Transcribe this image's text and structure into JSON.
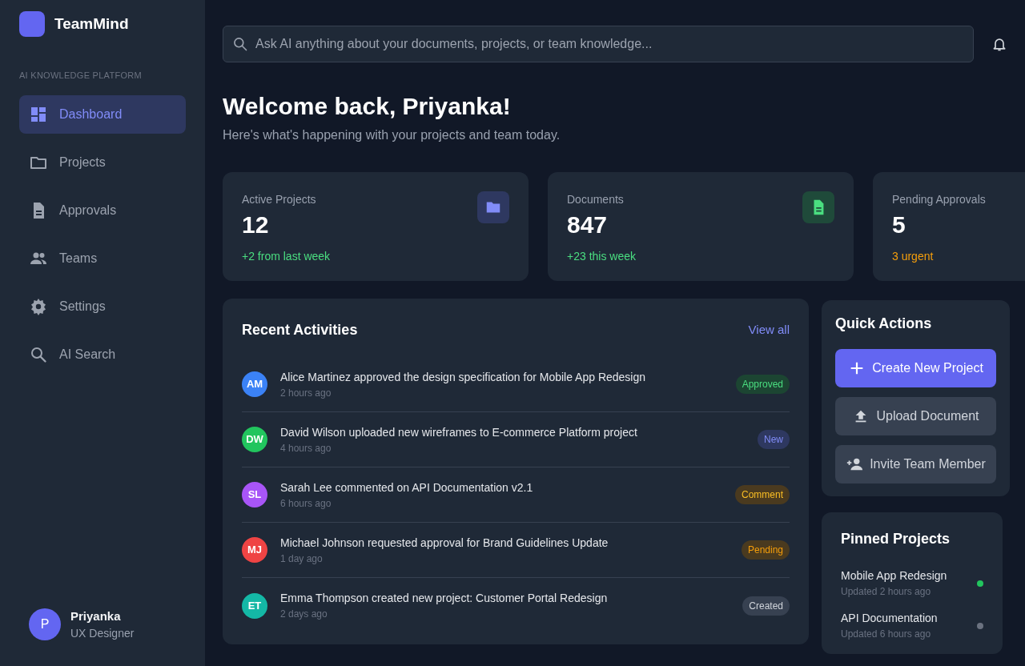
{
  "brand": {
    "name": "TeamMind",
    "tagline": "AI KNOWLEDGE PLATFORM"
  },
  "sidebar": {
    "items": [
      {
        "label": "Dashboard",
        "kind": "dashboard",
        "selected": true
      },
      {
        "label": "Projects",
        "kind": "projects",
        "selected": false
      },
      {
        "label": "Approvals",
        "kind": "approvals",
        "selected": false
      },
      {
        "label": "Teams",
        "kind": "teams",
        "selected": false
      },
      {
        "label": "Settings",
        "kind": "settings",
        "selected": false
      },
      {
        "label": "AI Search",
        "kind": "search",
        "selected": false
      }
    ]
  },
  "user": {
    "initial": "P",
    "name": "Priyanka",
    "role": "UX Designer"
  },
  "search": {
    "placeholder": "Ask AI anything about your documents, projects, or team knowledge..."
  },
  "welcome": {
    "title": "Welcome back, Priyanka!",
    "subtitle": "Here's what's happening with your projects and team today."
  },
  "stats": [
    {
      "label": "Active Projects",
      "value": "12",
      "note": "+2 from last week",
      "kind": "projects"
    },
    {
      "label": "Documents",
      "value": "847",
      "note": "+23 this week",
      "kind": "documents"
    },
    {
      "label": "Pending Approvals",
      "value": "5",
      "note": "3 urgent",
      "kind": "approvals"
    }
  ],
  "activities": {
    "title": "Recent Activities",
    "link": "View all",
    "items": [
      {
        "initials": "AM",
        "color": "#3b82f6",
        "text": "Alice Martinez approved the design specification for Mobile App Redesign",
        "time": "2 hours ago",
        "badge": "Approved",
        "kind": "approved"
      },
      {
        "initials": "DW",
        "color": "#22c55e",
        "text": "David Wilson uploaded new wireframes to E-commerce Platform project",
        "time": "4 hours ago",
        "badge": "New",
        "kind": "new"
      },
      {
        "initials": "SL",
        "color": "#a855f7",
        "text": "Sarah Lee commented on API Documentation v2.1",
        "time": "6 hours ago",
        "badge": "Comment",
        "kind": "comment"
      },
      {
        "initials": "MJ",
        "color": "#ef4444",
        "text": "Michael Johnson requested approval for Brand Guidelines Update",
        "time": "1 day ago",
        "badge": "Pending",
        "kind": "pending"
      },
      {
        "initials": "ET",
        "color": "#14b8a6",
        "text": "Emma Thompson created new project: Customer Portal Redesign",
        "time": "2 days ago",
        "badge": "Created",
        "kind": "created"
      }
    ]
  },
  "quick_actions": {
    "title": "Quick Actions",
    "buttons": [
      {
        "label": "Create New Project",
        "kind": "create"
      },
      {
        "label": "Upload Document",
        "kind": "upload"
      },
      {
        "label": "Invite Team Member",
        "kind": "invite"
      }
    ]
  },
  "pinned": {
    "title": "Pinned Projects",
    "items": [
      {
        "name": "Mobile App Redesign",
        "updated": "Updated 2 hours ago",
        "color": "#22c55e"
      },
      {
        "name": "API Documentation",
        "updated": "Updated 6 hours ago",
        "color": "#6b7280"
      }
    ]
  }
}
